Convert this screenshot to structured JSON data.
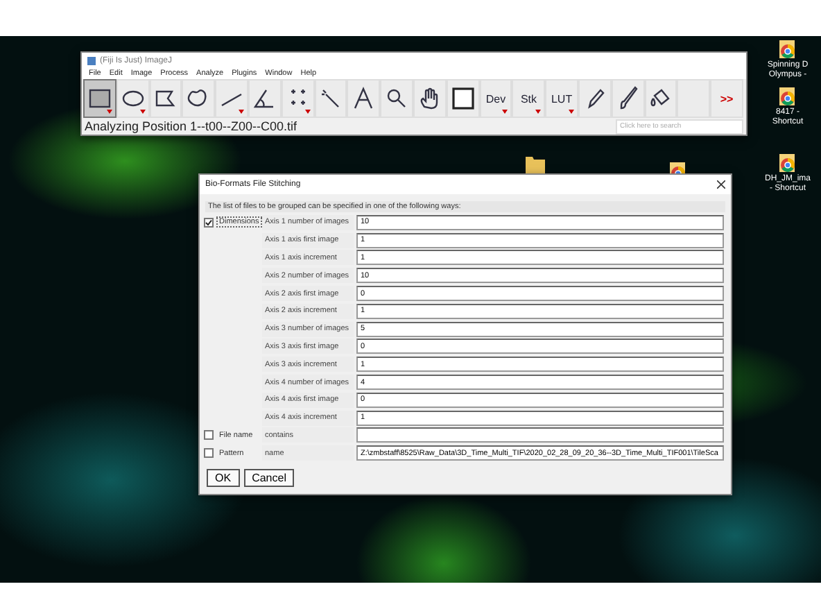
{
  "desktop_icons": [
    {
      "kind": "shortcut",
      "lines": [
        "Spinning D",
        "Olympus -"
      ]
    },
    {
      "kind": "shortcut",
      "lines": [
        "8417 -",
        "Shortcut"
      ]
    },
    {
      "kind": "shortcut",
      "lines": [
        "DH_JM_ima",
        "- Shortcut"
      ]
    },
    {
      "kind": "folder"
    },
    {
      "kind": "shortcut"
    }
  ],
  "fiji": {
    "title": "(Fiji Is Just) ImageJ",
    "menu": [
      "File",
      "Edit",
      "Image",
      "Process",
      "Analyze",
      "Plugins",
      "Window",
      "Help"
    ],
    "tools": [
      {
        "kind": "rectangle",
        "selected": true,
        "submenu": true
      },
      {
        "kind": "oval",
        "selected": false,
        "submenu": true
      },
      {
        "kind": "polygon",
        "selected": false,
        "submenu": false
      },
      {
        "kind": "freehand",
        "selected": false,
        "submenu": false
      },
      {
        "kind": "line",
        "selected": false,
        "submenu": true
      },
      {
        "kind": "angle",
        "selected": false,
        "submenu": false
      },
      {
        "kind": "points",
        "selected": false,
        "submenu": true
      },
      {
        "kind": "wand",
        "selected": false,
        "submenu": false
      },
      {
        "kind": "text",
        "selected": false,
        "submenu": false
      },
      {
        "kind": "zoom",
        "selected": false,
        "submenu": false
      },
      {
        "kind": "hand",
        "selected": false,
        "submenu": false
      },
      {
        "kind": "color",
        "selected": false,
        "submenu": false
      },
      {
        "kind": "label",
        "label": "Dev",
        "selected": false,
        "submenu": true
      },
      {
        "kind": "label",
        "label": "Stk",
        "selected": false,
        "submenu": true
      },
      {
        "kind": "label",
        "label": "LUT",
        "selected": false,
        "submenu": true
      },
      {
        "kind": "pencil",
        "selected": false,
        "submenu": false
      },
      {
        "kind": "brush",
        "selected": false,
        "submenu": false
      },
      {
        "kind": "fill",
        "selected": false,
        "submenu": false
      },
      {
        "kind": "blank",
        "selected": false,
        "submenu": false
      },
      {
        "kind": "more",
        "label": ">>",
        "selected": false,
        "submenu": false
      }
    ],
    "status": "Analyzing Position 1--t00--Z00--C00.tif",
    "search": {
      "placeholder": "Click here to search"
    }
  },
  "dialog": {
    "title": "Bio-Formats File Stitching",
    "instruction": "The list of files to be grouped can be specified in one of the following ways:",
    "groups": [
      {
        "label": "Dimensions",
        "checked": true,
        "rows": [
          {
            "label": "Axis 1 number of images",
            "value": "10"
          },
          {
            "label": "Axis 1 axis first image",
            "value": "1"
          },
          {
            "label": "Axis 1 axis increment",
            "value": "1"
          },
          {
            "label": "Axis 2 number of images",
            "value": "10"
          },
          {
            "label": "Axis 2 axis first image",
            "value": "0"
          },
          {
            "label": "Axis 2 axis increment",
            "value": "1"
          },
          {
            "label": "Axis 3 number of images",
            "value": "5"
          },
          {
            "label": "Axis 3 axis first image",
            "value": "0"
          },
          {
            "label": "Axis 3 axis increment",
            "value": "1"
          },
          {
            "label": "Axis 4 number of images",
            "value": "4"
          },
          {
            "label": "Axis 4 axis first image",
            "value": "0"
          },
          {
            "label": "Axis 4 axis increment",
            "value": "1"
          }
        ]
      },
      {
        "label": "File name",
        "checked": false,
        "rows": [
          {
            "label": "contains"
          }
        ]
      },
      {
        "label": "Pattern",
        "checked": false,
        "rows": [
          {
            "label": "name",
            "value": "Z:\\zmbstaff\\8525\\Raw_Data\\3D_Time_Multi_TIF\\2020_02_28_09_20_36--3D_Time_Multi_TIF001\\TileSca"
          }
        ]
      }
    ],
    "buttons": [
      "OK",
      "Cancel"
    ]
  }
}
